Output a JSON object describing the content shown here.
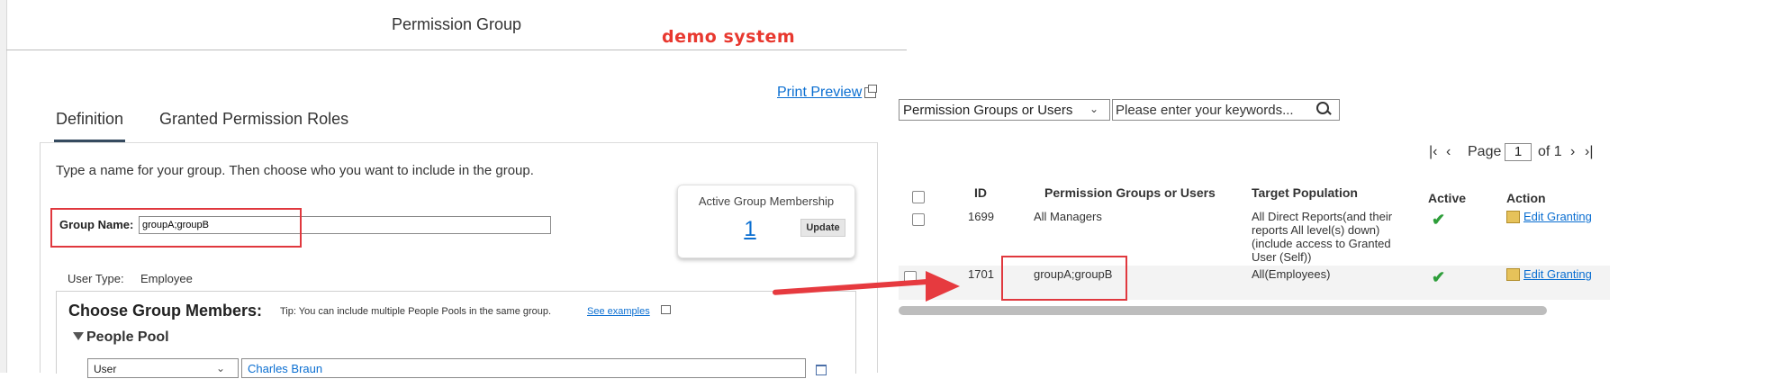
{
  "dialog": {
    "title": "Permission Group",
    "watermark": "demo system",
    "print_preview": "Print Preview",
    "tabs": [
      {
        "label": "Definition",
        "active": true
      },
      {
        "label": "Granted Permission Roles",
        "active": false
      }
    ],
    "intro": "Type a name for your group. Then choose who you want to include in the group.",
    "membership": {
      "title": "Active Group Membership",
      "count": "1",
      "update_label": "Update"
    },
    "group_name": {
      "label": "Group Name:",
      "value": "groupA;groupB"
    },
    "user_type": {
      "label": "User Type:",
      "value": "Employee"
    },
    "choose": {
      "title": "Choose Group Members:",
      "tip": "Tip: You can include multiple People Pools in the same group.",
      "see_examples": "See examples",
      "people_pool": "People Pool",
      "pool_type": "User",
      "pool_user": "Charles Braun"
    }
  },
  "search": {
    "filter_value": "Permission Groups or Users",
    "placeholder": "Please enter your keywords..."
  },
  "pager": {
    "label": "Page",
    "current": "1",
    "of_text": "of 1"
  },
  "table": {
    "headers": {
      "id": "ID",
      "name": "Permission Groups or Users",
      "target": "Target Population",
      "active": "Active",
      "action": "Action"
    },
    "rows": [
      {
        "id": "1699",
        "name": "All Managers",
        "target_lines": [
          "All Direct Reports(and their",
          "reports All level(s) down)",
          "(include access to Granted",
          "User (Self))"
        ],
        "active": "✔",
        "action": "Edit Granting"
      },
      {
        "id": "1701",
        "name": "groupA;groupB",
        "target_lines": [
          "All(Employees)"
        ],
        "active": "✔",
        "action": "Edit Granting"
      }
    ]
  },
  "colors": {
    "link": "#0a6ed1",
    "highlight_box": "#e0383e",
    "active_check": "#2e9e3a",
    "watermark": "#e8382f"
  }
}
